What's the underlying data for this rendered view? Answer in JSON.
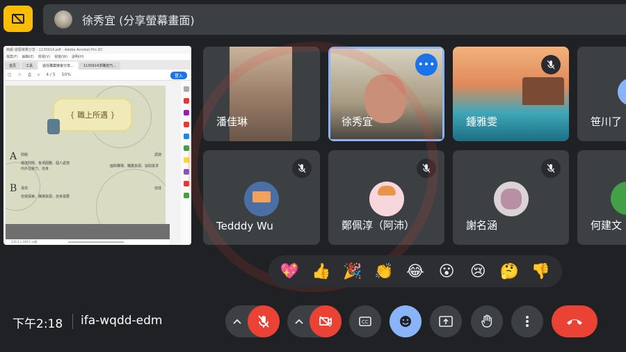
{
  "presenter": {
    "name": "徐秀宜 (分享螢幕畫面)",
    "icon": "present-off-icon"
  },
  "shared_screen": {
    "window_title": "簡報-發展導覽分享 - 1130914.pdf - Adobe Acrobat Pro DC",
    "menu": [
      "檔案(F)",
      "編輯(E)",
      "檢視(V)",
      "視窗(W)",
      "說明(H)"
    ],
    "tabs": [
      "首頁",
      "工具",
      "過任職業機會分享...",
      "1130914求職技巧..."
    ],
    "toolbar": {
      "page": "4 / 5",
      "zoom": "50%",
      "login": "登入"
    },
    "doc_title": "{ 職上所遇 }",
    "doc_lines": [
      "問題",
      "環境問題、各項困難、個人處境",
      "內外在壓力、自身",
      "尋找",
      "自我探索、職場資源、自身需要",
      "面對職場、職業資源、協助需求",
      "調適",
      "達成"
    ],
    "letters": [
      "A",
      "B"
    ],
    "status": "230.2 x 109.5 公厘"
  },
  "participants": [
    {
      "name": "潘佳琳",
      "muted": false,
      "kind": "video"
    },
    {
      "name": "徐秀宜",
      "muted": false,
      "kind": "video",
      "speaking": true
    },
    {
      "name": "鍾雅雯",
      "muted": true,
      "kind": "image"
    },
    {
      "name": "笹川了",
      "muted": true,
      "kind": "avatar"
    },
    {
      "name": "Tedddy Wu",
      "muted": true,
      "kind": "avatar"
    },
    {
      "name": "鄭佩淳（阿沛）",
      "muted": true,
      "kind": "avatar"
    },
    {
      "name": "謝名涵",
      "muted": true,
      "kind": "avatar"
    },
    {
      "name": "何建文",
      "muted": true,
      "kind": "avatar"
    }
  ],
  "reactions": [
    "💖",
    "👍",
    "🎉",
    "👏",
    "😂",
    "😮",
    "😢",
    "🤔",
    "👎"
  ],
  "bottom": {
    "time": "下午2:18",
    "meeting_code": "ifa-wqdd-edm"
  },
  "colors": {
    "accent_yellow": "#fbbc04",
    "danger": "#ea4335",
    "active_blue": "#8ab4f8",
    "tile_bg": "#3c4043"
  }
}
